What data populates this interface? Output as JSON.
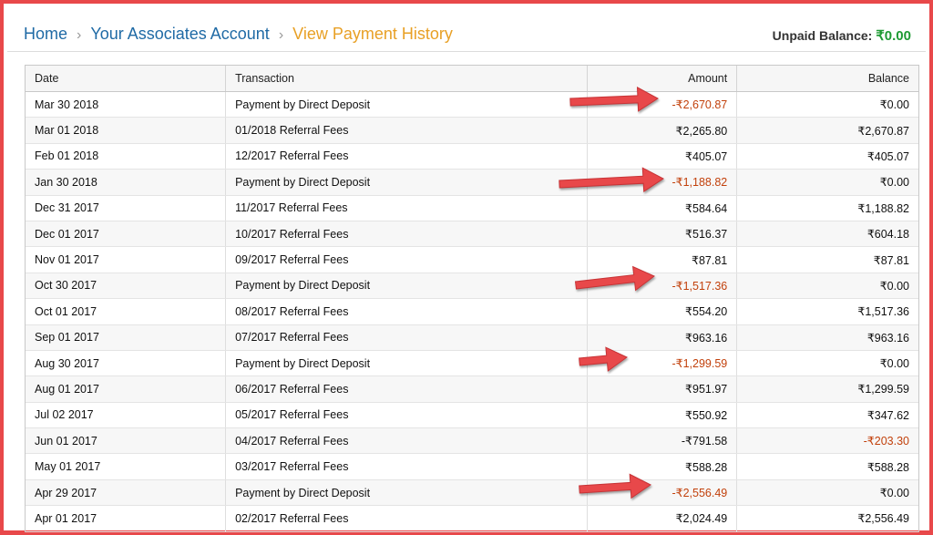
{
  "breadcrumb": {
    "home": "Home",
    "account": "Your Associates Account",
    "current": "View Payment History",
    "separator": "›"
  },
  "unpaid": {
    "label": "Unpaid Balance:",
    "value": "₹0.00"
  },
  "table": {
    "headers": {
      "date": "Date",
      "transaction": "Transaction",
      "amount": "Amount",
      "balance": "Balance"
    },
    "rows": [
      {
        "date": "Mar 30 2018",
        "transaction": "Payment by Direct Deposit",
        "amount": "-₹2,670.87",
        "balance": "₹0.00"
      },
      {
        "date": "Mar 01 2018",
        "transaction": "01/2018 Referral Fees",
        "amount": "₹2,265.80",
        "balance": "₹2,670.87"
      },
      {
        "date": "Feb 01 2018",
        "transaction": "12/2017 Referral Fees",
        "amount": "₹405.07",
        "balance": "₹405.07"
      },
      {
        "date": "Jan 30 2018",
        "transaction": "Payment by Direct Deposit",
        "amount": "-₹1,188.82",
        "balance": "₹0.00"
      },
      {
        "date": "Dec 31 2017",
        "transaction": "11/2017 Referral Fees",
        "amount": "₹584.64",
        "balance": "₹1,188.82"
      },
      {
        "date": "Dec 01 2017",
        "transaction": "10/2017 Referral Fees",
        "amount": "₹516.37",
        "balance": "₹604.18"
      },
      {
        "date": "Nov 01 2017",
        "transaction": "09/2017 Referral Fees",
        "amount": "₹87.81",
        "balance": "₹87.81"
      },
      {
        "date": "Oct 30 2017",
        "transaction": "Payment by Direct Deposit",
        "amount": "-₹1,517.36",
        "balance": "₹0.00"
      },
      {
        "date": "Oct 01 2017",
        "transaction": "08/2017 Referral Fees",
        "amount": "₹554.20",
        "balance": "₹1,517.36"
      },
      {
        "date": "Sep 01 2017",
        "transaction": "07/2017 Referral Fees",
        "amount": "₹963.16",
        "balance": "₹963.16"
      },
      {
        "date": "Aug 30 2017",
        "transaction": "Payment by Direct Deposit",
        "amount": "-₹1,299.59",
        "balance": "₹0.00"
      },
      {
        "date": "Aug 01 2017",
        "transaction": "06/2017 Referral Fees",
        "amount": "₹951.97",
        "balance": "₹1,299.59"
      },
      {
        "date": "Jul 02 2017",
        "transaction": "05/2017 Referral Fees",
        "amount": "₹550.92",
        "balance": "₹347.62"
      },
      {
        "date": "Jun 01 2017",
        "transaction": "04/2017 Referral Fees",
        "amount": "-₹791.58",
        "balance": "-₹203.30"
      },
      {
        "date": "May 01 2017",
        "transaction": "03/2017 Referral Fees",
        "amount": "₹588.28",
        "balance": "₹588.28"
      },
      {
        "date": "Apr 29 2017",
        "transaction": "Payment by Direct Deposit",
        "amount": "-₹2,556.49",
        "balance": "₹0.00"
      },
      {
        "date": "Apr 01 2017",
        "transaction": "02/2017 Referral Fees",
        "amount": "₹2,024.49",
        "balance": "₹2,556.49"
      }
    ]
  },
  "colors": {
    "frame": "#e8484a",
    "link": "#1f6aa5",
    "current_crumb": "#e8a025",
    "positive_balance": "#1e9a33",
    "payment_amount": "#c2410c",
    "arrow": "#e8484a"
  }
}
